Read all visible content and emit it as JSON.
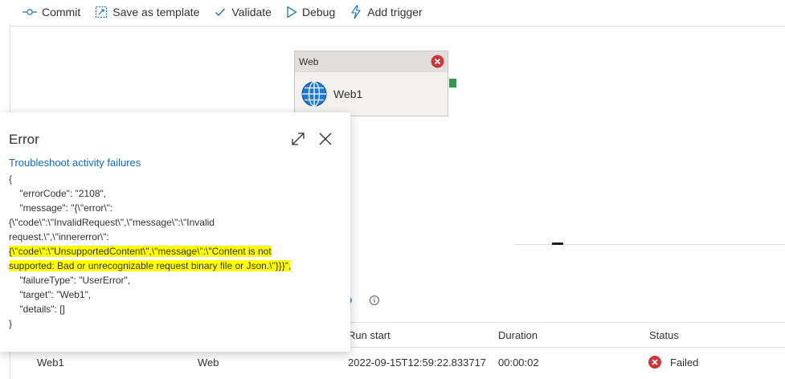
{
  "toolbar": {
    "commit": "Commit",
    "save_template": "Save as template",
    "validate": "Validate",
    "debug": "Debug",
    "add_trigger": "Add trigger"
  },
  "activity": {
    "type": "Web",
    "name": "Web1"
  },
  "error_panel": {
    "title": "Error",
    "link": "Troubleshoot activity failures",
    "lines": {
      "l0": "{",
      "l1": "    \"errorCode\": \"2108\",",
      "l2": "    \"message\": \"{\\\"error\\\":",
      "l3": "{\\\"code\\\":\\\"InvalidRequest\\\",\\\"message\\\":\\\"Invalid",
      "l4": "request.\\\",\\\"innererror\\\":",
      "l5": "{\\\"code\\\":\\\"UnsupportedContent\\\",\\\"message\\\":\\\"Content is not",
      "l6": "supported: Bad or unrecognizable request binary file or Json.\\\"}}}\",",
      "l7": "    \"failureType\": \"UserError\",",
      "l8": "    \"target\": \"Web1\",",
      "l9": "    \"details\": []",
      "l10": "}"
    }
  },
  "table": {
    "headers": {
      "run_start": "Run start",
      "duration": "Duration",
      "status": "Status"
    },
    "row": {
      "name": "Web1",
      "type": "Web",
      "run_start": "2022-09-15T12:59:22.833717",
      "duration": "00:00:02",
      "status": "Failed"
    }
  },
  "colors": {
    "error_red": "#d13438",
    "link_blue": "#0f6cbd",
    "highlight": "#ffff00",
    "port_green": "#2e9c4b"
  }
}
